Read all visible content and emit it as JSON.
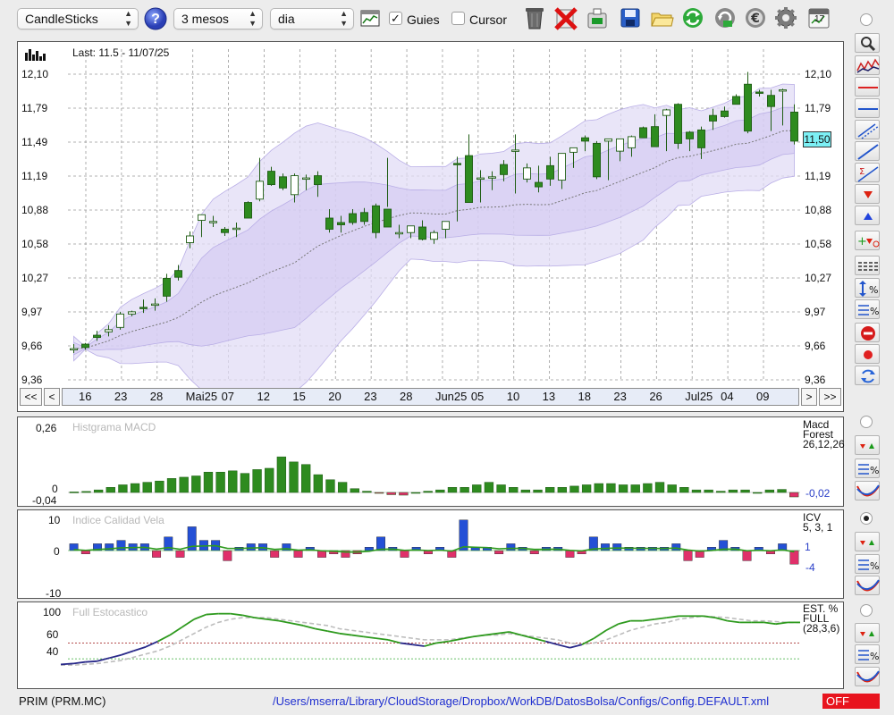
{
  "toolbar": {
    "chart_type": "CandleSticks",
    "period": "3 mesos",
    "interval": "dia",
    "guides_label": "Guies",
    "guides_checked": true,
    "cursor_label": "Cursor",
    "cursor_checked": false,
    "calendar_day": "17",
    "icons": [
      "help-icon",
      "chart-window-icon",
      "trash-icon",
      "delete-icon",
      "portfolio-icon",
      "save-icon",
      "open-folder-icon",
      "refresh-icon",
      "reload-icon",
      "euro-icon",
      "settings-icon",
      "calendar-icon"
    ]
  },
  "main_chart": {
    "last_label": "Last: 11.5 - 11/07/25",
    "current_price": "11,50",
    "y_ticks": [
      "12,10",
      "11,79",
      "11,49",
      "11,19",
      "10,88",
      "10,58",
      "10,27",
      "9,97",
      "9,66",
      "9,36"
    ],
    "x_ticks": [
      "16",
      "23",
      "28",
      "Mai25",
      "07",
      "12",
      "15",
      "20",
      "23",
      "28",
      "Jun25",
      "05",
      "10",
      "13",
      "18",
      "23",
      "26",
      "Jul25",
      "04",
      "09"
    ],
    "nav": {
      "first": "<<",
      "prev": "<",
      "next": ">",
      "last": ">>"
    }
  },
  "macd_panel": {
    "title": "Histgrama MACD",
    "name_line1": "Macd",
    "name_line2": "Forest",
    "params": "26,12,26",
    "y_ticks": [
      "0,26",
      "0",
      "-0,04"
    ],
    "current_value": "-0,02"
  },
  "icv_panel": {
    "title": "Indice Calidad Vela",
    "name": "ICV",
    "params": "5, 3, 1",
    "y_ticks": [
      "10",
      "0",
      "-10"
    ],
    "value_positive": "1",
    "value_negative": "-4"
  },
  "stoch_panel": {
    "title": "Full Estocastico",
    "name_line1": "EST. %",
    "name_line2": "FULL",
    "params": "(28,3,6)",
    "y_ticks": [
      "100",
      "60",
      "40"
    ]
  },
  "status_bar": {
    "symbol": "PRIM (PRM.MC)",
    "config_path": "/Users/mserra/Library/CloudStorage/Dropbox/WorkDB/DatosBolsa/Configs/Config.DEFAULT.xml",
    "mode_badge": "OFF"
  },
  "colors": {
    "bull_candle": "#2e8b1f",
    "bear_candle": "#ffffff",
    "band_fill": "#e2dcf6",
    "macd_bar": "#2e8b1f",
    "icv_pos": "#2450d6",
    "icv_neg": "#e0306a",
    "stoch_line": "#2e9a1e",
    "off_badge": "#e8141e"
  },
  "chart_data": [
    {
      "type": "candlestick",
      "title": "",
      "ylim": [
        9.36,
        12.1
      ],
      "series": [
        {
          "values": [
            [
              9.64,
              9.68,
              9.6,
              9.64
            ],
            [
              9.68,
              9.69,
              9.63,
              9.65
            ],
            [
              9.76,
              9.8,
              9.71,
              9.74
            ],
            [
              9.79,
              9.85,
              9.75,
              9.81
            ],
            [
              9.83,
              9.97,
              9.81,
              9.95
            ],
            [
              9.95,
              9.98,
              9.93,
              9.97
            ],
            [
              10.01,
              10.08,
              9.96,
              10.0
            ],
            [
              10.03,
              10.09,
              9.98,
              10.04
            ],
            [
              10.27,
              10.31,
              10.06,
              10.11
            ],
            [
              10.34,
              10.39,
              10.25,
              10.28
            ],
            [
              10.59,
              10.69,
              10.54,
              10.65
            ],
            [
              10.79,
              10.84,
              10.64,
              10.84
            ],
            [
              10.78,
              10.83,
              10.73,
              10.78
            ],
            [
              10.71,
              10.73,
              10.65,
              10.68
            ],
            [
              10.72,
              10.77,
              10.64,
              10.72
            ],
            [
              10.95,
              10.96,
              10.82,
              10.81
            ],
            [
              10.98,
              11.35,
              10.96,
              11.14
            ],
            [
              11.23,
              11.27,
              11.1,
              11.11
            ],
            [
              11.18,
              11.21,
              11.06,
              11.08
            ],
            [
              11.02,
              11.21,
              10.95,
              11.19
            ],
            [
              11.16,
              11.2,
              11.06,
              11.17
            ],
            [
              11.19,
              11.23,
              11.0,
              11.11
            ],
            [
              10.81,
              10.89,
              10.68,
              10.71
            ],
            [
              10.77,
              10.83,
              10.68,
              10.75
            ],
            [
              10.85,
              10.89,
              10.75,
              10.77
            ],
            [
              10.86,
              10.9,
              10.75,
              10.78
            ],
            [
              10.92,
              10.94,
              10.63,
              10.68
            ],
            [
              10.89,
              11.35,
              10.91,
              10.73
            ],
            [
              10.68,
              10.75,
              10.63,
              10.68
            ],
            [
              10.68,
              10.73,
              10.63,
              10.74
            ],
            [
              10.73,
              10.79,
              10.61,
              10.62
            ],
            [
              10.62,
              10.7,
              10.58,
              10.68
            ],
            [
              10.71,
              10.73,
              10.63,
              10.78
            ],
            [
              11.3,
              11.36,
              10.78,
              11.29
            ],
            [
              11.37,
              11.56,
              11.29,
              10.95
            ],
            [
              11.17,
              11.24,
              10.95,
              11.17
            ],
            [
              11.17,
              11.23,
              11.06,
              11.18
            ],
            [
              11.29,
              11.33,
              11.14,
              11.2
            ],
            [
              11.42,
              11.56,
              11.03,
              11.42
            ],
            [
              11.16,
              11.3,
              11.13,
              11.26
            ],
            [
              11.13,
              11.28,
              11.04,
              11.09
            ],
            [
              11.28,
              11.36,
              11.1,
              11.16
            ],
            [
              11.15,
              11.21,
              11.07,
              11.39
            ],
            [
              11.4,
              11.43,
              11.26,
              11.44
            ],
            [
              11.53,
              11.55,
              11.41,
              11.5
            ],
            [
              11.48,
              11.5,
              11.16,
              11.18
            ],
            [
              11.5,
              11.52,
              11.15,
              11.52
            ],
            [
              11.41,
              11.5,
              11.32,
              11.52
            ],
            [
              11.44,
              11.55,
              11.36,
              11.54
            ],
            [
              11.62,
              11.63,
              11.55,
              11.53
            ],
            [
              11.63,
              11.74,
              11.47,
              11.45
            ],
            [
              11.73,
              11.79,
              11.41,
              11.78
            ],
            [
              11.83,
              11.84,
              11.43,
              11.48
            ],
            [
              11.58,
              11.59,
              11.41,
              11.52
            ],
            [
              11.6,
              11.63,
              11.34,
              11.44
            ],
            [
              11.73,
              11.79,
              11.6,
              11.68
            ],
            [
              11.77,
              11.81,
              11.71,
              11.72
            ],
            [
              11.9,
              11.92,
              11.86,
              11.83
            ],
            [
              12.01,
              12.12,
              11.57,
              11.59
            ],
            [
              11.94,
              11.96,
              11.9,
              11.93
            ],
            [
              11.91,
              11.96,
              11.59,
              11.81
            ],
            [
              11.95,
              11.97,
              11.64,
              11.96
            ],
            [
              11.76,
              11.83,
              11.47,
              11.5
            ]
          ]
        }
      ]
    },
    {
      "type": "bar",
      "title": "Histgrama MACD",
      "ylim": [
        -0.04,
        0.26
      ],
      "series": [
        {
          "values": [
            0.002,
            0.004,
            0.01,
            0.02,
            0.03,
            0.035,
            0.04,
            0.045,
            0.055,
            0.06,
            0.065,
            0.08,
            0.08,
            0.085,
            0.075,
            0.09,
            0.095,
            0.14,
            0.12,
            0.11,
            0.07,
            0.05,
            0.04,
            0.015,
            0.005,
            -0.004,
            -0.01,
            -0.012,
            0.0,
            0.005,
            0.01,
            0.02,
            0.02,
            0.03,
            0.04,
            0.03,
            0.02,
            0.01,
            0.01,
            0.02,
            0.02,
            0.025,
            0.03,
            0.035,
            0.035,
            0.03,
            0.03,
            0.035,
            0.04,
            0.03,
            0.02,
            0.01,
            0.01,
            0.005,
            0.01,
            0.01,
            0.0,
            0.01,
            0.012,
            -0.02
          ]
        }
      ]
    },
    {
      "type": "bar",
      "title": "Indice Calidad Vela",
      "ylim": [
        -10,
        10
      ],
      "series": [
        {
          "values": [
            2,
            -1,
            2,
            2,
            3,
            2,
            2,
            -2,
            4,
            -2,
            7,
            3,
            3,
            -3,
            1,
            2,
            2,
            -2,
            2,
            -2,
            1,
            -2,
            -1,
            -2,
            -1,
            1,
            4,
            1,
            -2,
            1,
            -1,
            1,
            -2,
            9,
            1,
            1,
            -1,
            2,
            1,
            -1,
            1,
            1,
            -2,
            -1,
            4,
            2,
            2,
            1,
            1,
            1,
            1,
            2,
            -3,
            -2,
            1,
            3,
            1,
            -3,
            1,
            -1,
            2,
            -4
          ]
        }
      ]
    },
    {
      "type": "line",
      "title": "Full Estocastico",
      "ylim": [
        30,
        100
      ],
      "series": [
        {
          "values": [
            33,
            34,
            36,
            37,
            41,
            45,
            50,
            55,
            62,
            70,
            80,
            90,
            96,
            97,
            97,
            95,
            92,
            90,
            88,
            85,
            82,
            78,
            75,
            72,
            70,
            68,
            66,
            64,
            60,
            58,
            56,
            60,
            62,
            65,
            68,
            70,
            72,
            74,
            70,
            66,
            62,
            58,
            54,
            58,
            66,
            76,
            84,
            88,
            88,
            90,
            92,
            94,
            94,
            94,
            92,
            88,
            86,
            86,
            86,
            84,
            86,
            86
          ]
        },
        {
          "values": [
            32,
            32,
            33,
            34,
            36,
            38,
            42,
            46,
            50,
            56,
            64,
            72,
            80,
            86,
            90,
            92,
            92,
            92,
            90,
            88,
            86,
            84,
            82,
            78,
            76,
            74,
            72,
            70,
            68,
            66,
            64,
            64,
            64,
            66,
            68,
            70,
            70,
            72,
            70,
            68,
            66,
            64,
            60,
            58,
            60,
            64,
            70,
            76,
            80,
            84,
            86,
            90,
            92,
            94,
            93,
            92,
            90,
            88,
            88,
            87,
            86,
            86
          ]
        }
      ]
    }
  ]
}
